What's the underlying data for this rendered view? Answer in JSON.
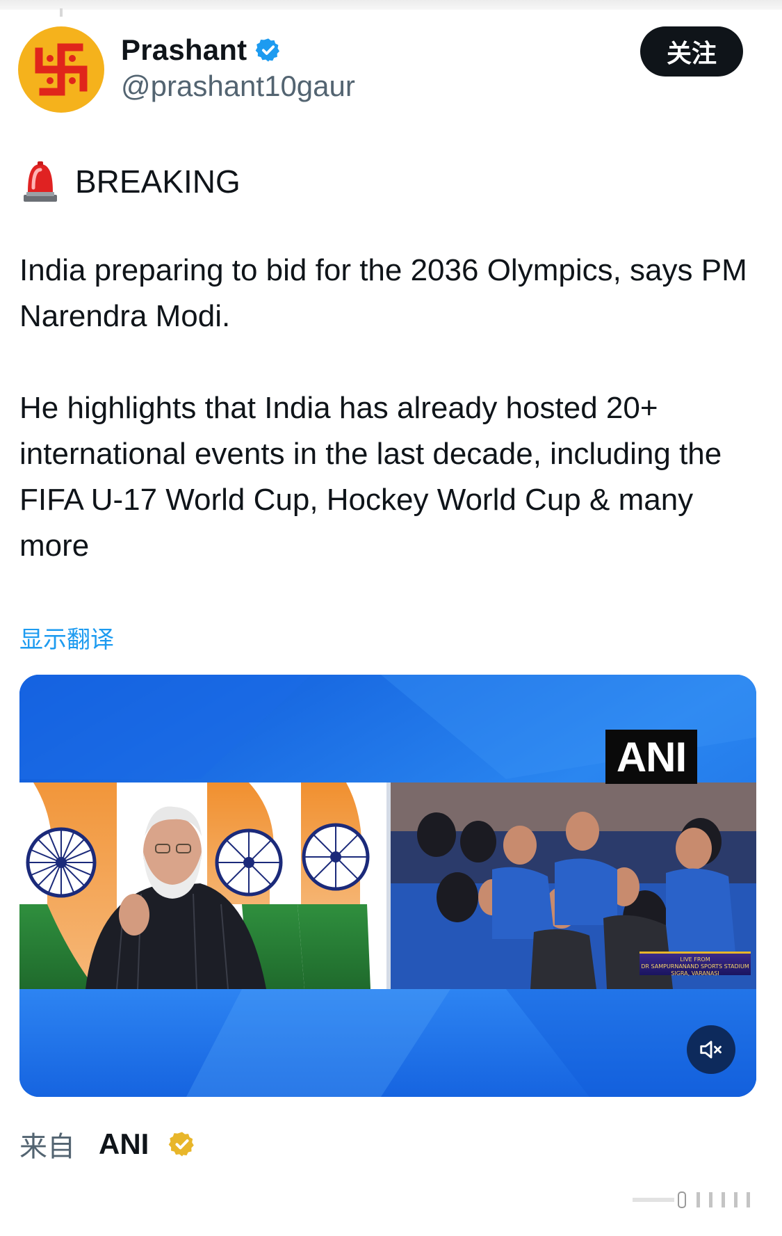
{
  "header": {
    "author_name": "Prashant",
    "author_handle": "@prashant10gaur",
    "follow_label": "关注",
    "avatar_icon": "swastika-icon",
    "verified_icon": "verified-badge-icon"
  },
  "tweet": {
    "breaking_emoji": "siren-icon",
    "breaking_label": "BREAKING",
    "paragraph_1": "India preparing to bid for the 2036 Olympics, says PM Narendra Modi.",
    "paragraph_2": "He highlights that India has already hosted 20+ international events in the last decade, including the FIFA U-17 World Cup, Hockey World Cup & many more",
    "translate_label": "显示翻译"
  },
  "media": {
    "watermark": "ANI",
    "caption_line_1": "LIVE FROM",
    "caption_line_2": "DR SAMPURNANAND SPORTS STADIUM",
    "caption_line_3": "SIGRA, VARANASI",
    "mute_icon": "speaker-muted-icon"
  },
  "footer": {
    "source_prefix": "来自",
    "source_name": "ANI",
    "source_badge_icon": "gold-verified-badge-icon"
  },
  "colors": {
    "link": "#1d9bf0",
    "handle": "#536471",
    "avatar_bg": "#f5b21c",
    "avatar_symbol": "#e0251b",
    "verified": "#1d9bf0",
    "gold_badge": "#e8b62a",
    "media_bg": "#1766e0"
  }
}
